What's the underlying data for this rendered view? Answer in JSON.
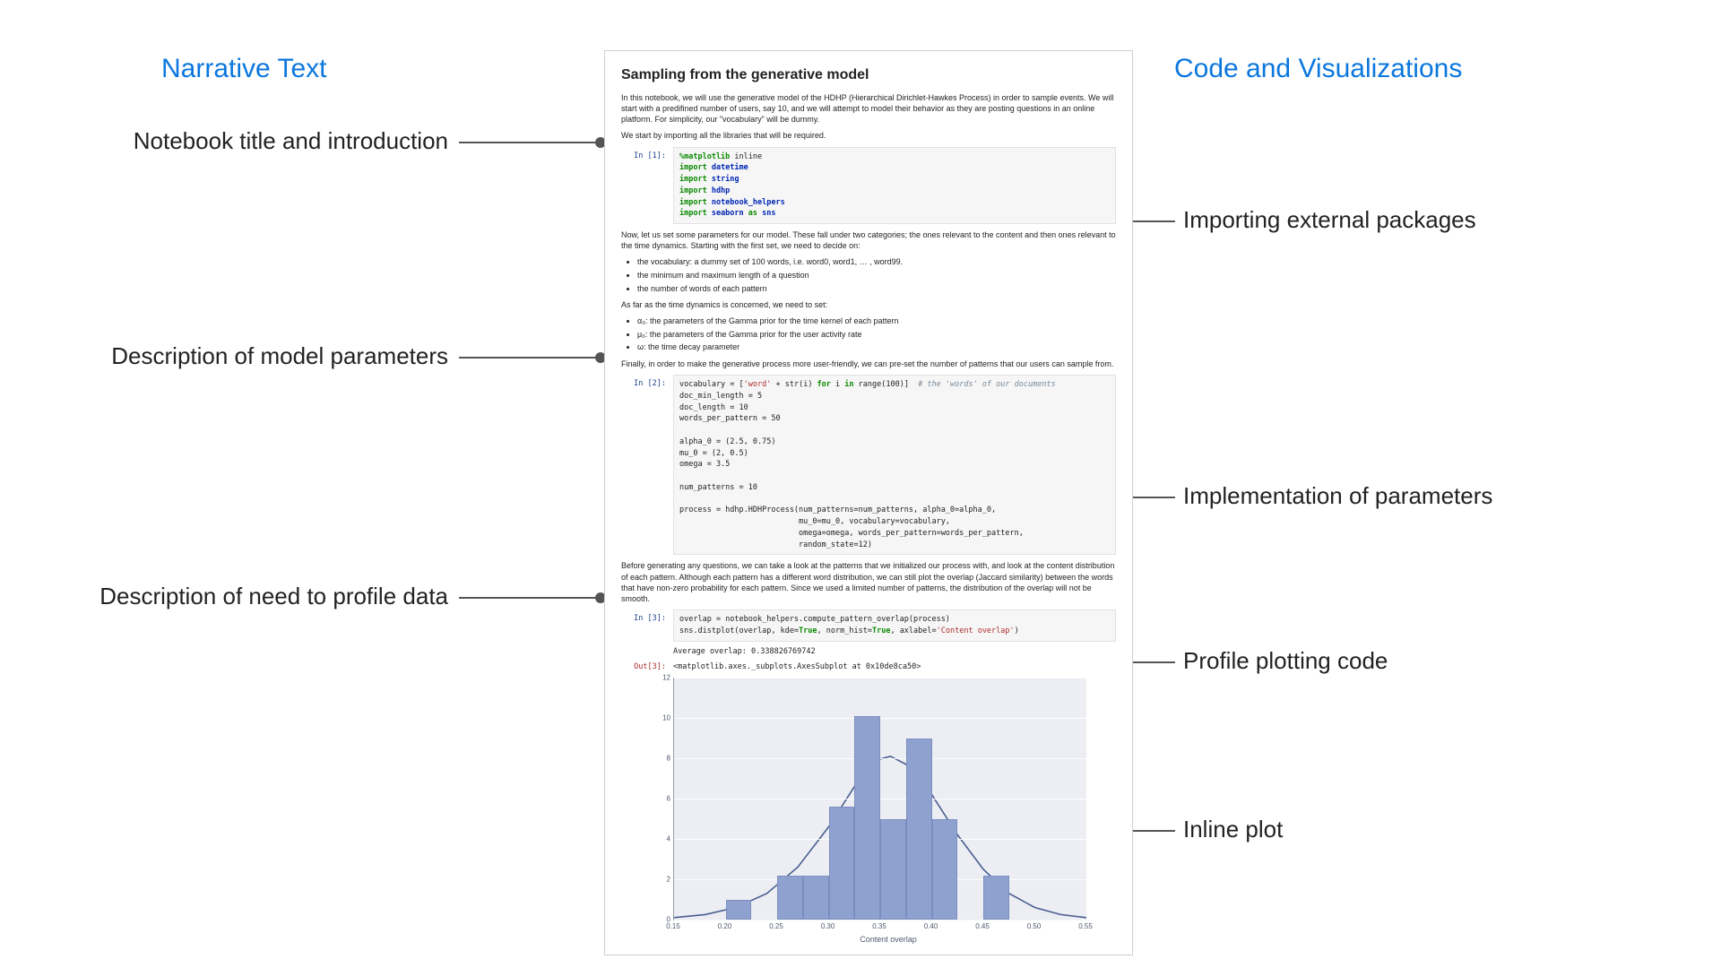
{
  "headers": {
    "left": "Narrative Text",
    "right": "Code and Visualizations"
  },
  "annotations": {
    "left": {
      "a1": "Notebook title and introduction",
      "a2": "Description of model parameters",
      "a3": "Description of need to profile data"
    },
    "right": {
      "b1": "Importing external packages",
      "b2": "Implementation of parameters",
      "b3": "Profile plotting code",
      "b4": "Inline plot"
    }
  },
  "notebook": {
    "title": "Sampling from the generative model",
    "intro1": "In this notebook, we will use the generative model of the HDHP (Hierarchical Dirichlet-Hawkes Process) in order to sample events. We will start with a predifined number of users, say 10, and we will attempt to model their behavior as they are posting questions in an online platform. For simplicity, our \"vocabulary\" will be dummy.",
    "intro2": "We start by importing all the libraries that will be required.",
    "params_p": "Now, let us set some parameters for our model. These fall under two categories; the ones relevant to the content and then ones relevant to the time dynamics. Starting with the first set, we need to decide on:",
    "params_ul": [
      "the vocabulary: a dummy set of 100 words, i.e. word0, word1, … , word99.",
      "the minimum and maximum length of a question",
      "the number of words of each pattern"
    ],
    "time_p": "As far as the time dynamics is concerned, we need to set:",
    "time_ul_a0": "α₀: the parameters of the Gamma prior for the time kernel of each pattern",
    "time_ul_mu0": "μ₀: the parameters of the Gamma prior for the user activity rate",
    "time_ul_omega": "ω: the time decay parameter",
    "finally_p": "Finally, in order to make the generative process more user-friendly, we can pre-set the number of patterns that our users can sample from.",
    "profile_p": "Before generating any questions, we can take a look at the patterns that we initialized our process with, and look at the content distribution of each pattern. Although each pattern has a different word distribution, we can still plot the overlap (Jaccard similarity) between the words that have non-zero probability for each pattern. Since we used a limited number of patterns, the distribution of the overlap will not be smooth.",
    "stdout": "Average overlap: 0.338826769742",
    "out3": "<matplotlib.axes._subplots.AxesSubplot at 0x10de8ca50>",
    "prompts": {
      "in1": "In [1]:",
      "in2": "In [2]:",
      "in3": "In [3]:",
      "out3": "Out[3]:"
    },
    "code1": {
      "magic1": "%matplotlib",
      "magic2": " inline",
      "imp": "import ",
      "m1": "datetime",
      "m2": "string",
      "m3": "hdhp",
      "m4": "notebook_helpers",
      "m5": "seaborn",
      "as": " as ",
      "alias5": "sns"
    },
    "code2": {
      "l1a": "vocabulary = [",
      "l1b": "'word'",
      "l1c": " + str(i) ",
      "l1d": "for",
      "l1e": " i ",
      "l1f": "in",
      "l1g": " range(100)]  ",
      "l1h": "# the 'words' of our documents",
      "l2": "doc_min_length = 5",
      "l3": "doc_length = 10",
      "l4": "words_per_pattern = 50",
      "l5": "",
      "l6": "alpha_0 = (2.5, 0.75)",
      "l7": "mu_0 = (2, 0.5)",
      "l8": "omega = 3.5",
      "l9": "",
      "l10": "num_patterns = 10",
      "l11": "",
      "l12": "process = hdhp.HDHProcess(num_patterns=num_patterns, alpha_0=alpha_0,",
      "l13": "                          mu_0=mu_0, vocabulary=vocabulary,",
      "l14": "                          omega=omega, words_per_pattern=words_per_pattern,",
      "l15": "                          random_state=12)"
    },
    "code3": {
      "l1": "overlap = notebook_helpers.compute_pattern_overlap(process)",
      "l2a": "sns.distplot(overlap, kde=",
      "l2b": "True",
      "l2c": ", norm_hist=",
      "l2d": "True",
      "l2e": ", axlabel=",
      "l2f": "'Content overlap'",
      "l2g": ")"
    }
  },
  "chart_data": {
    "type": "bar+kde",
    "xlabel": "Content overlap",
    "ylabel": "",
    "xlim": [
      0.15,
      0.55
    ],
    "ylim": [
      0,
      12
    ],
    "xticks": [
      0.15,
      0.2,
      0.25,
      0.3,
      0.35,
      0.4,
      0.45,
      0.5,
      0.55
    ],
    "yticks": [
      0,
      2,
      4,
      6,
      8,
      10,
      12
    ],
    "bin_width": 0.025,
    "bars": [
      {
        "x": 0.2,
        "y": 1.0
      },
      {
        "x": 0.25,
        "y": 2.2
      },
      {
        "x": 0.275,
        "y": 2.2
      },
      {
        "x": 0.3,
        "y": 5.6
      },
      {
        "x": 0.325,
        "y": 10.1
      },
      {
        "x": 0.35,
        "y": 5.0
      },
      {
        "x": 0.375,
        "y": 9.0
      },
      {
        "x": 0.4,
        "y": 5.0
      },
      {
        "x": 0.45,
        "y": 2.2
      }
    ],
    "kde": [
      {
        "x": 0.15,
        "y": 0.1
      },
      {
        "x": 0.18,
        "y": 0.25
      },
      {
        "x": 0.21,
        "y": 0.6
      },
      {
        "x": 0.24,
        "y": 1.3
      },
      {
        "x": 0.27,
        "y": 2.6
      },
      {
        "x": 0.3,
        "y": 4.6
      },
      {
        "x": 0.325,
        "y": 6.6
      },
      {
        "x": 0.345,
        "y": 7.9
      },
      {
        "x": 0.36,
        "y": 8.1
      },
      {
        "x": 0.375,
        "y": 7.7
      },
      {
        "x": 0.4,
        "y": 6.2
      },
      {
        "x": 0.425,
        "y": 4.2
      },
      {
        "x": 0.45,
        "y": 2.5
      },
      {
        "x": 0.475,
        "y": 1.3
      },
      {
        "x": 0.5,
        "y": 0.6
      },
      {
        "x": 0.525,
        "y": 0.25
      },
      {
        "x": 0.55,
        "y": 0.1
      }
    ]
  }
}
